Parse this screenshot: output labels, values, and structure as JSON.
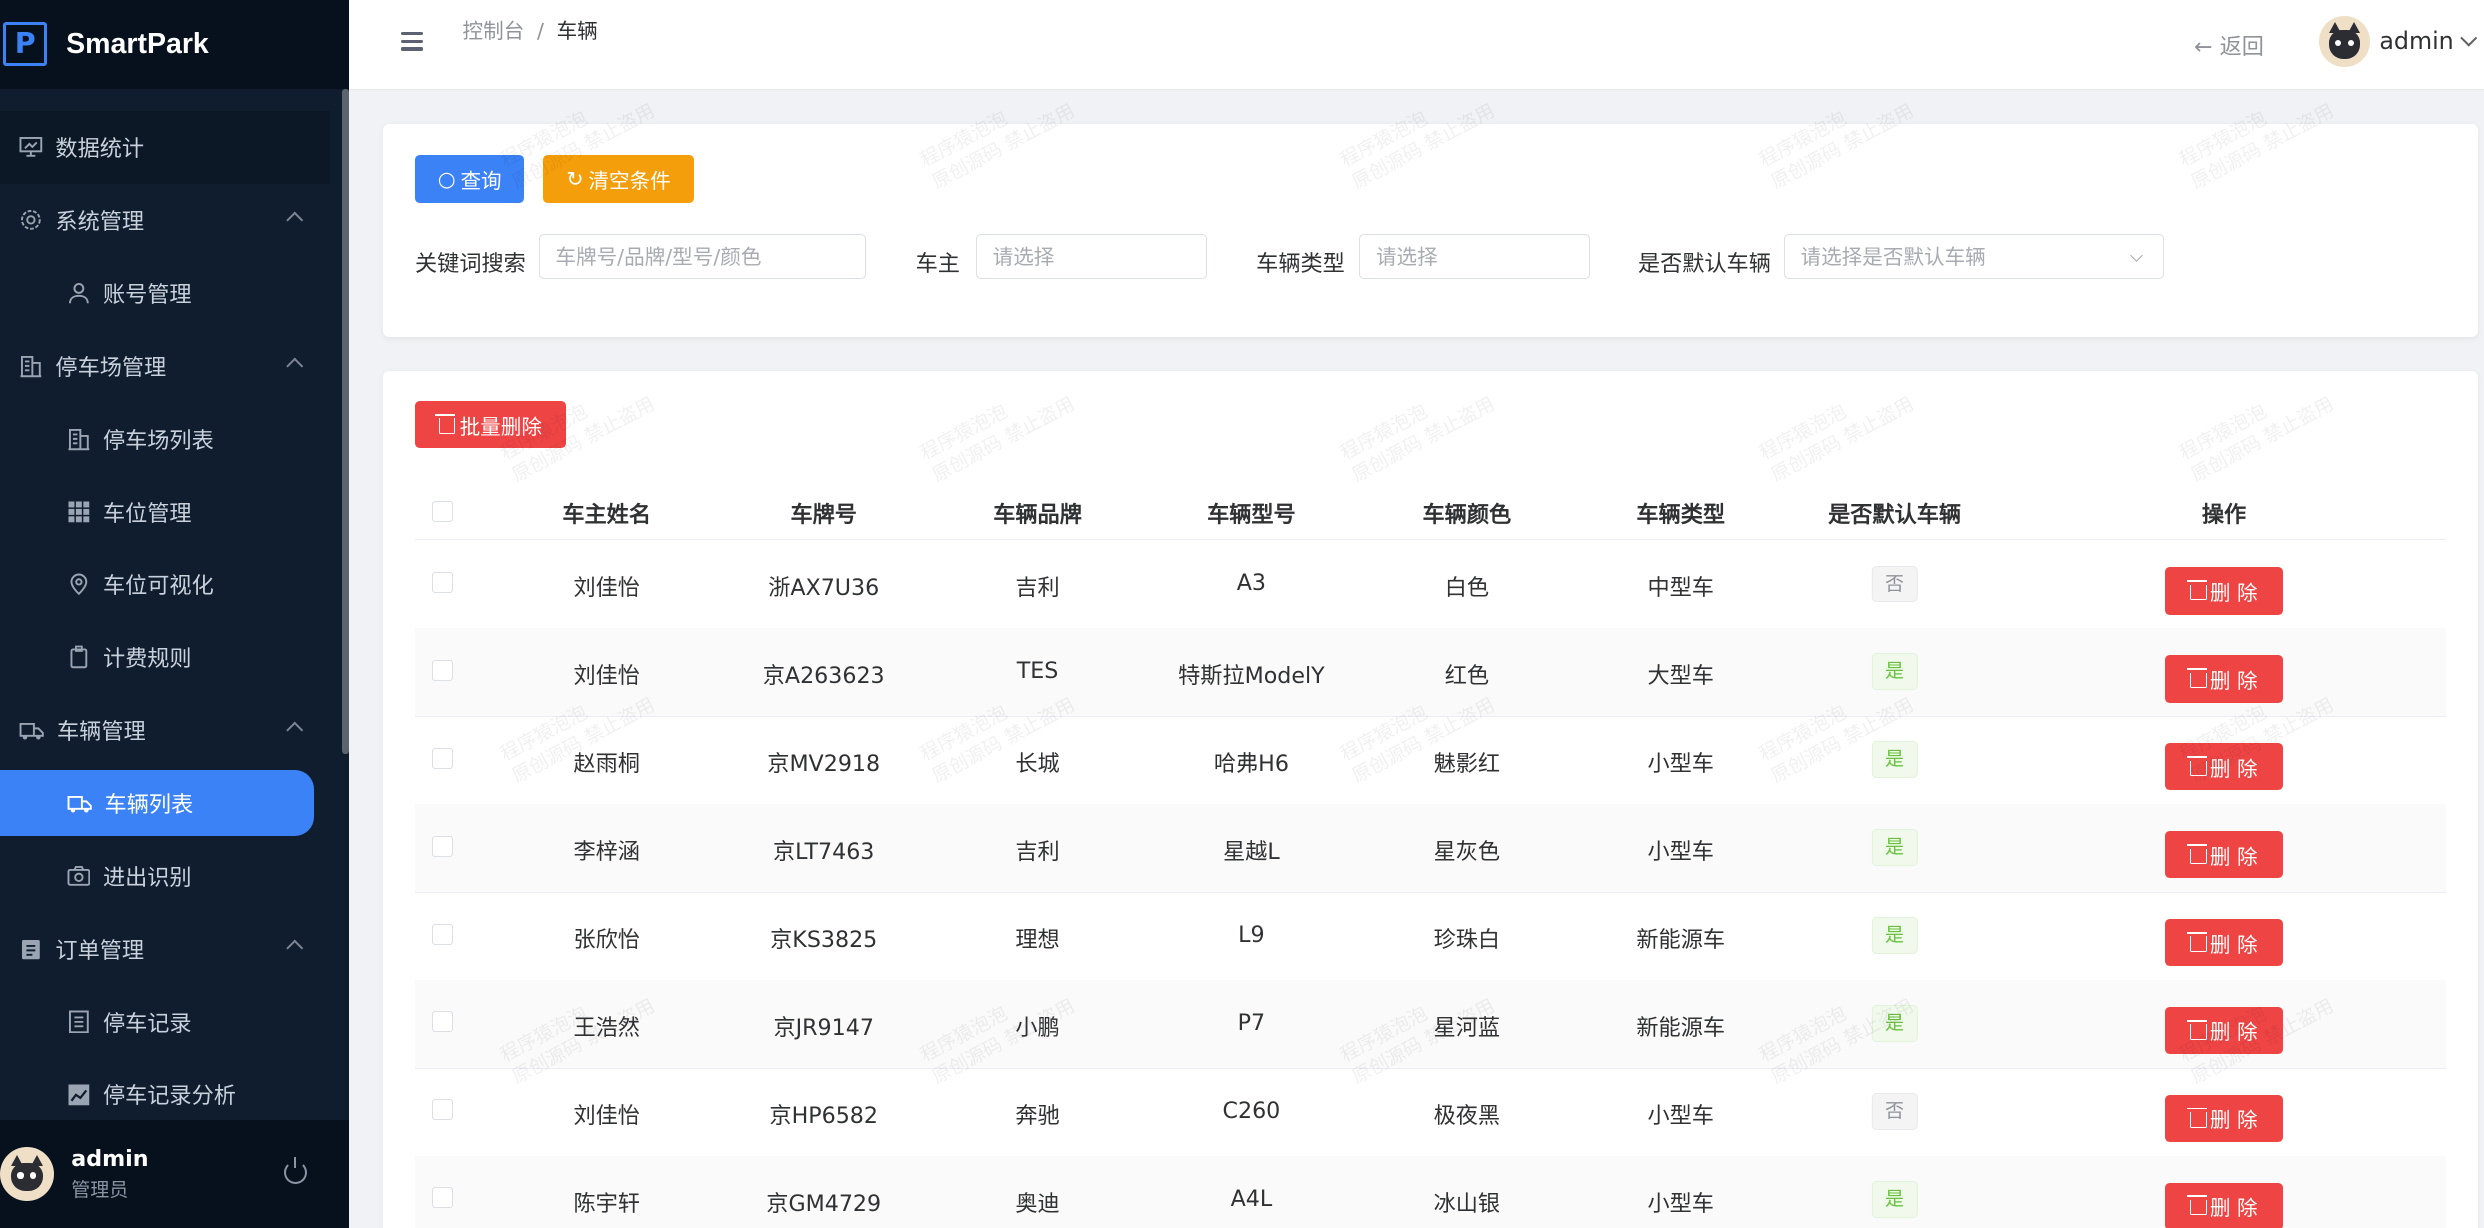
{
  "app": {
    "brand": "SmartPark",
    "logo_letter": "P"
  },
  "sidebar": {
    "items": [
      {
        "label": "数据统计",
        "level": 1,
        "icon": "monitor-chart-icon",
        "state": "first"
      },
      {
        "label": "系统管理",
        "level": 1,
        "icon": "gear-icon",
        "expanded": true
      },
      {
        "label": "账号管理",
        "level": 2,
        "icon": "user-icon"
      },
      {
        "label": "停车场管理",
        "level": 1,
        "icon": "building-icon",
        "expanded": true
      },
      {
        "label": "停车场列表",
        "level": 2,
        "icon": "building-icon"
      },
      {
        "label": "车位管理",
        "level": 2,
        "icon": "grid-icon"
      },
      {
        "label": "车位可视化",
        "level": 2,
        "icon": "location-pin-icon"
      },
      {
        "label": "计费规则",
        "level": 2,
        "icon": "clipboard-icon"
      },
      {
        "label": "车辆管理",
        "level": 1,
        "icon": "truck-icon",
        "expanded": true
      },
      {
        "label": "车辆列表",
        "level": 2,
        "icon": "truck-icon",
        "state": "active"
      },
      {
        "label": "进出识别",
        "level": 2,
        "icon": "camera-icon"
      },
      {
        "label": "订单管理",
        "level": 1,
        "icon": "clipboard-list-icon",
        "expanded": true
      },
      {
        "label": "停车记录",
        "level": 2,
        "icon": "document-icon"
      },
      {
        "label": "停车记录分析",
        "level": 2,
        "icon": "trend-chart-icon"
      }
    ],
    "user": {
      "name": "admin",
      "role": "管理员"
    }
  },
  "header": {
    "breadcrumb": [
      "控制台",
      "车辆"
    ],
    "breadcrumb_sep": "/",
    "back_label": "返回",
    "user_name": "admin"
  },
  "filters": {
    "search_button": "查询",
    "clear_button": "清空条件",
    "keyword": {
      "label": "关键词搜索",
      "placeholder": "车牌号/品牌/型号/颜色"
    },
    "owner": {
      "label": "车主",
      "placeholder": "请选择"
    },
    "vehicle_type": {
      "label": "车辆类型",
      "placeholder": "请选择"
    },
    "is_default": {
      "label": "是否默认车辆",
      "placeholder": "请选择是否默认车辆"
    }
  },
  "table": {
    "batch_delete": "批量删除",
    "columns": [
      "车主姓名",
      "车牌号",
      "车辆品牌",
      "车辆型号",
      "车辆颜色",
      "车辆类型",
      "是否默认车辆",
      "操作"
    ],
    "delete_label": "删 除",
    "rows": [
      {
        "owner": "刘佳怡",
        "plate": "浙AX7U36",
        "brand": "吉利",
        "model": "A3",
        "color": "白色",
        "type": "中型车",
        "default": "否"
      },
      {
        "owner": "刘佳怡",
        "plate": "京A263623",
        "brand": "TES",
        "model": "特斯拉ModelY",
        "color": "红色",
        "type": "大型车",
        "default": "是"
      },
      {
        "owner": "赵雨桐",
        "plate": "京MV2918",
        "brand": "长城",
        "model": "哈弗H6",
        "color": "魅影红",
        "type": "小型车",
        "default": "是"
      },
      {
        "owner": "李梓涵",
        "plate": "京LT7463",
        "brand": "吉利",
        "model": "星越L",
        "color": "星灰色",
        "type": "小型车",
        "default": "是"
      },
      {
        "owner": "张欣怡",
        "plate": "京KS3825",
        "brand": "理想",
        "model": "L9",
        "color": "珍珠白",
        "type": "新能源车",
        "default": "是"
      },
      {
        "owner": "王浩然",
        "plate": "京JR9147",
        "brand": "小鹏",
        "model": "P7",
        "color": "星河蓝",
        "type": "新能源车",
        "default": "是"
      },
      {
        "owner": "刘佳怡",
        "plate": "京HP6582",
        "brand": "奔驰",
        "model": "C260",
        "color": "极夜黑",
        "type": "小型车",
        "default": "否"
      },
      {
        "owner": "陈宇轩",
        "plate": "京GM4729",
        "brand": "奥迪",
        "model": "A4L",
        "color": "冰山银",
        "type": "小型车",
        "default": "是"
      }
    ]
  },
  "watermark": {
    "line1": "程序猿泡泡",
    "line2": "原创源码 禁止盗用"
  },
  "colors": {
    "primary": "#3b82f6",
    "danger": "#ef4444",
    "warning": "#f59e0b",
    "sidebar_bg": "#0f1d2e"
  }
}
